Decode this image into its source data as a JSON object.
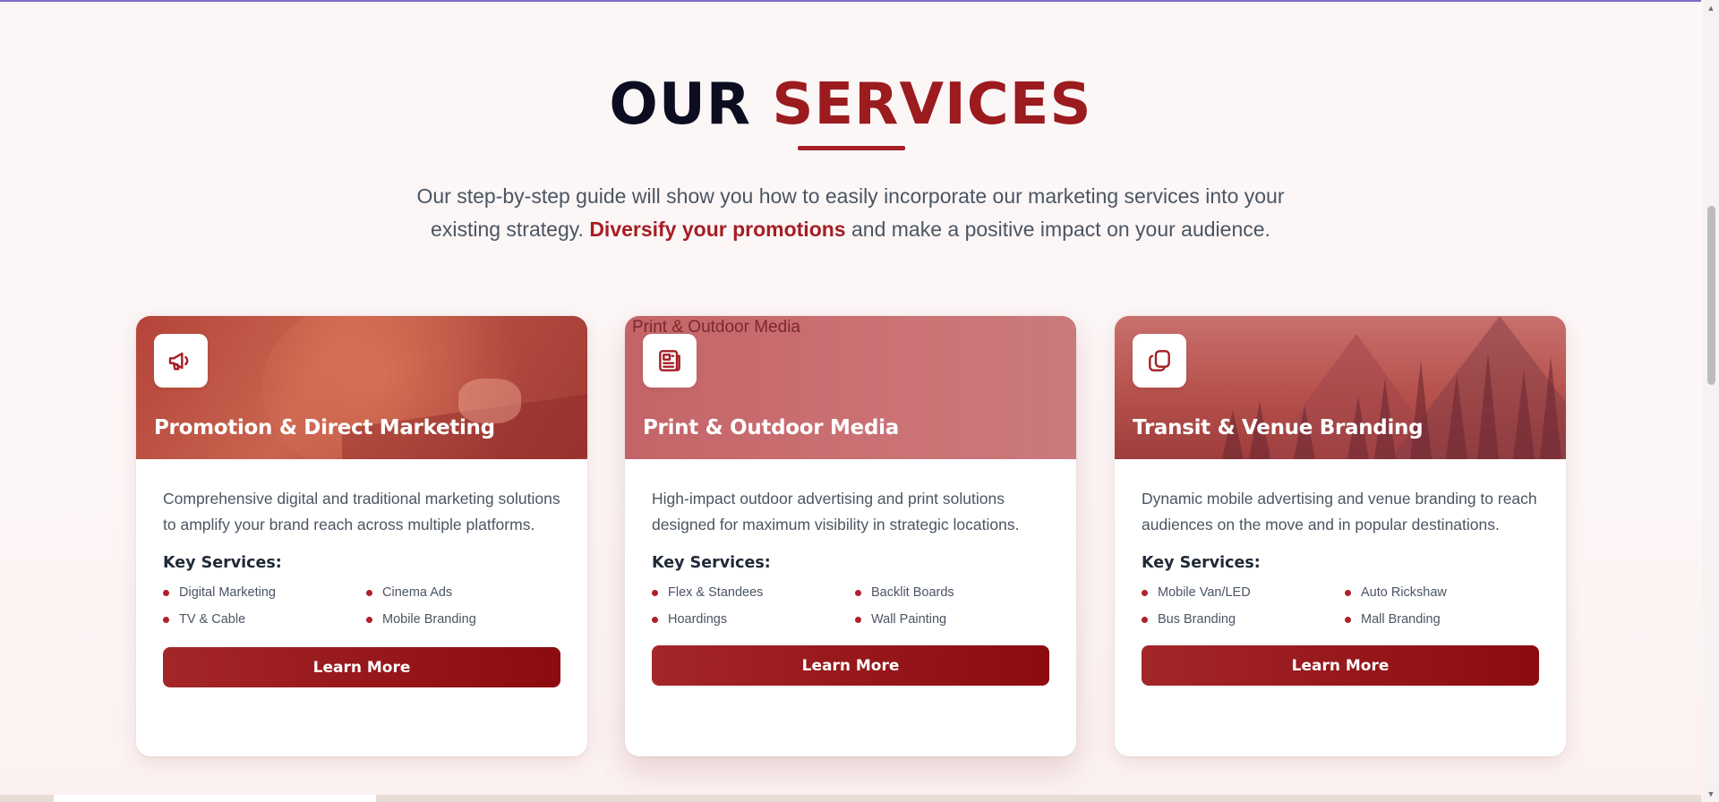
{
  "heading": {
    "word1": "OUR",
    "word2": "SERVICES",
    "colors": {
      "dark": "#0d0d22",
      "accent": "#9b1b1f"
    }
  },
  "intro": {
    "before": "Our step-by-step guide will show you how to easily incorporate our marketing services into your existing strategy. ",
    "highlight": "Diversify your promotions",
    "after": " and make a positive impact on your audience."
  },
  "cards": [
    {
      "icon": "megaphone-icon",
      "title": "Promotion & Direct Marketing",
      "description": "Comprehensive digital and traditional marketing solutions to amplify your brand reach across multiple platforms.",
      "key_label": "Key Services:",
      "services": [
        "Digital Marketing",
        "Cinema Ads",
        "TV & Cable",
        "Mobile Branding"
      ],
      "button": "Learn More"
    },
    {
      "icon": "newspaper-icon",
      "image_alt": "Print & Outdoor Media",
      "title": "Print & Outdoor Media",
      "description": "High-impact outdoor advertising and print solutions designed for maximum visibility in strategic locations.",
      "key_label": "Key Services:",
      "services": [
        "Flex & Standees",
        "Backlit Boards",
        "Hoardings",
        "Wall Painting"
      ],
      "button": "Learn More"
    },
    {
      "icon": "copy-icon",
      "title": "Transit & Venue Branding",
      "description": "Dynamic mobile advertising and venue branding to reach audiences on the move and in popular destinations.",
      "key_label": "Key Services:",
      "services": [
        "Mobile Van/LED",
        "Auto Rickshaw",
        "Bus Branding",
        "Mall Branding"
      ],
      "button": "Learn More"
    }
  ],
  "accent_color": "#a61d24"
}
